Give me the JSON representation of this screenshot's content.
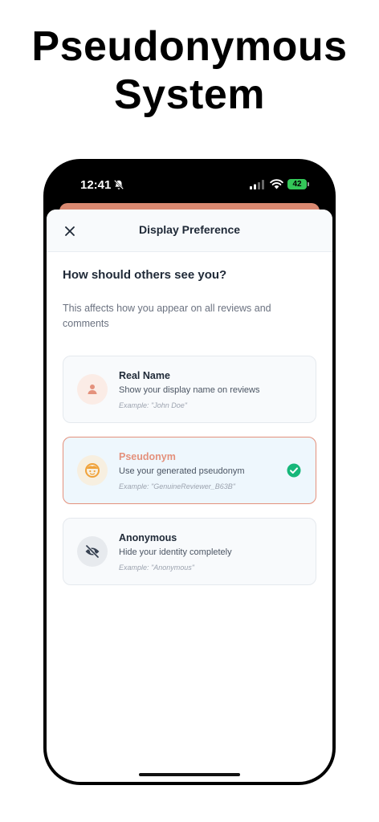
{
  "headline": {
    "line1": "Pseudonymous",
    "line2": "System"
  },
  "statusbar": {
    "time": "12:41",
    "battery": "42",
    "icons": [
      "bell-slash-icon",
      "signal-icon",
      "wifi-icon",
      "battery-icon"
    ]
  },
  "sheet": {
    "title": "Display Preference",
    "close_icon": "close-icon",
    "question": "How should others see you?",
    "description": "This affects how you appear on all reviews and comments"
  },
  "options": [
    {
      "title": "Real Name",
      "subtitle": "Show your display name on reviews",
      "example": "Example: \"John Doe\"",
      "icon": "person-icon",
      "selected": false
    },
    {
      "title": "Pseudonym",
      "subtitle": "Use your generated pseudonym",
      "example": "Example: \"GenuineReviewer_B63B\"",
      "icon": "face-icon",
      "selected": true
    },
    {
      "title": "Anonymous",
      "subtitle": "Hide your identity completely",
      "example": "Example: \"Anonymous\"",
      "icon": "eye-slash-icon",
      "selected": false
    }
  ],
  "colors": {
    "accent": "#e4917c",
    "check": "#16b77a",
    "selected_bg": "#eef7fd",
    "card_bg": "#f8fafc",
    "status_battery": "#34c759"
  }
}
